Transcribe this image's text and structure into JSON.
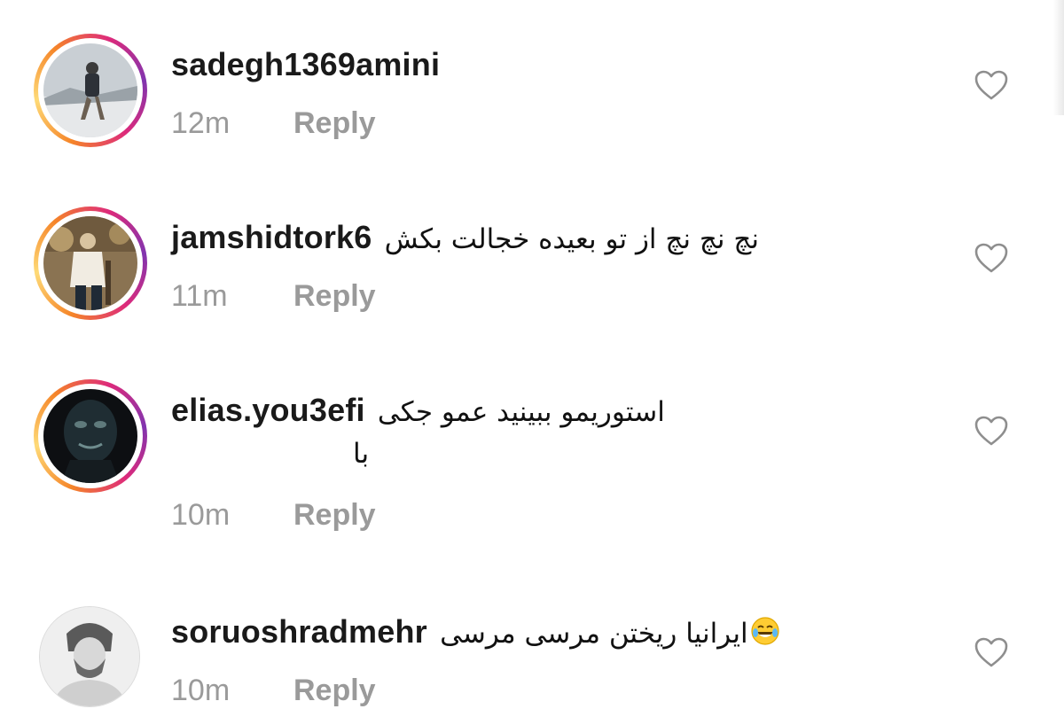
{
  "comments": [
    {
      "username": "sadegh1369amini",
      "text": "",
      "text2": "",
      "time": "12m",
      "reply_label": "Reply",
      "avatar_ring": true,
      "avatar_icon": "avatar-person-snow"
    },
    {
      "username": "jamshidtork6",
      "text": "نچ نچ نچ  از تو بعیده  خجالت بکش",
      "text2": "",
      "time": "11m",
      "reply_label": "Reply",
      "avatar_ring": true,
      "avatar_icon": "avatar-person-sepia"
    },
    {
      "username": "elias.you3efi",
      "text": "استوریمو ببینید عمو جکی",
      "text2": "با",
      "time": "10m",
      "reply_label": "Reply",
      "avatar_ring": true,
      "avatar_icon": "avatar-dark-mask"
    },
    {
      "username": "soruoshradmehr",
      "text": "ایرانیا ریختن مرسی مرسی",
      "text2": "",
      "emoji": "tears-of-joy-emoji",
      "time": "10m",
      "reply_label": "Reply",
      "avatar_ring": false,
      "avatar_icon": "avatar-grayscale-portrait"
    }
  ],
  "icons": {
    "like": "heart-outline-icon"
  },
  "colors": {
    "ring_start": "#f58529",
    "ring_mid": "#dd2a7b",
    "ring_end": "#8134af",
    "meta_text": "#9a9a9a",
    "username": "#1a1a1a"
  }
}
